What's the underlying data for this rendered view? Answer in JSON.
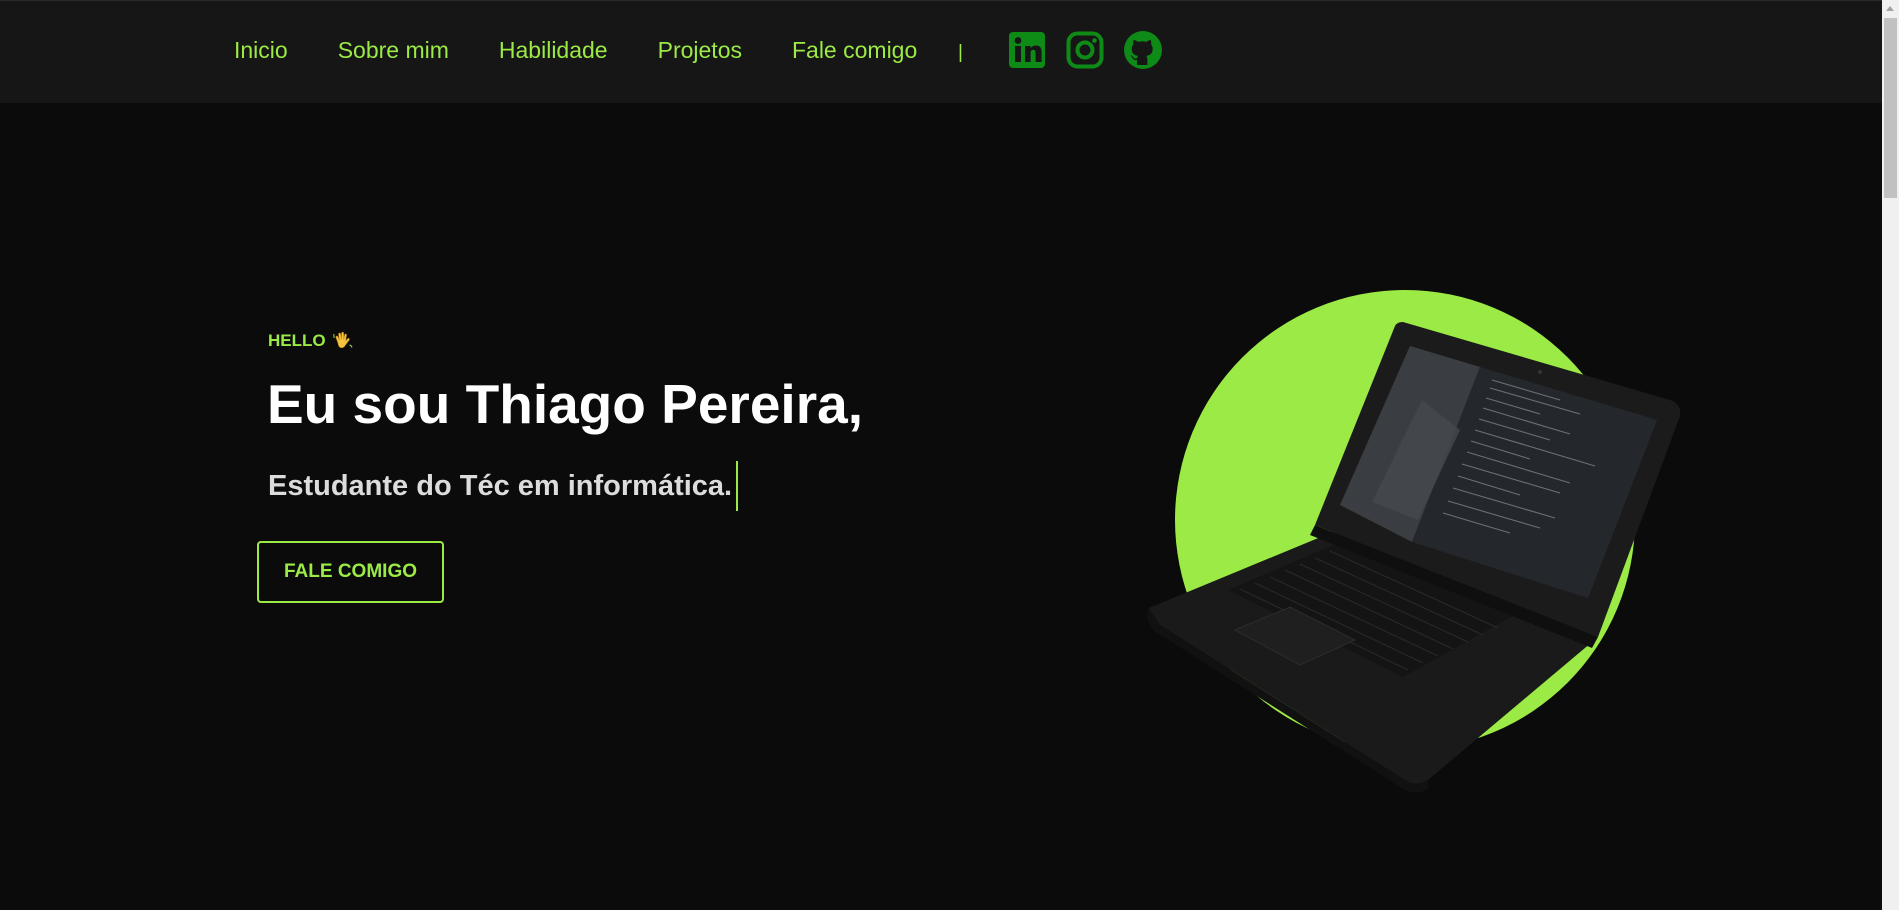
{
  "nav": {
    "links": [
      {
        "label": "Inicio"
      },
      {
        "label": "Sobre mim"
      },
      {
        "label": "Habilidade"
      },
      {
        "label": "Projetos"
      },
      {
        "label": "Fale comigo"
      }
    ],
    "separator": "|",
    "socials": [
      {
        "icon": "linkedin-icon"
      },
      {
        "icon": "instagram-icon"
      },
      {
        "icon": "github-icon"
      }
    ]
  },
  "hero": {
    "greeting": "HELLO",
    "greeting_icon": "waving-hand-icon",
    "title": "Eu sou Thiago Pereira,",
    "subtitle": "Estudante do Téc em informática.",
    "cta_label": "FALE COMIGO",
    "image": "laptop-image"
  },
  "colors": {
    "accent": "#9bea45",
    "background": "#0b0b0b",
    "navbar": "#161616",
    "icon_green": "#0e8a17"
  }
}
